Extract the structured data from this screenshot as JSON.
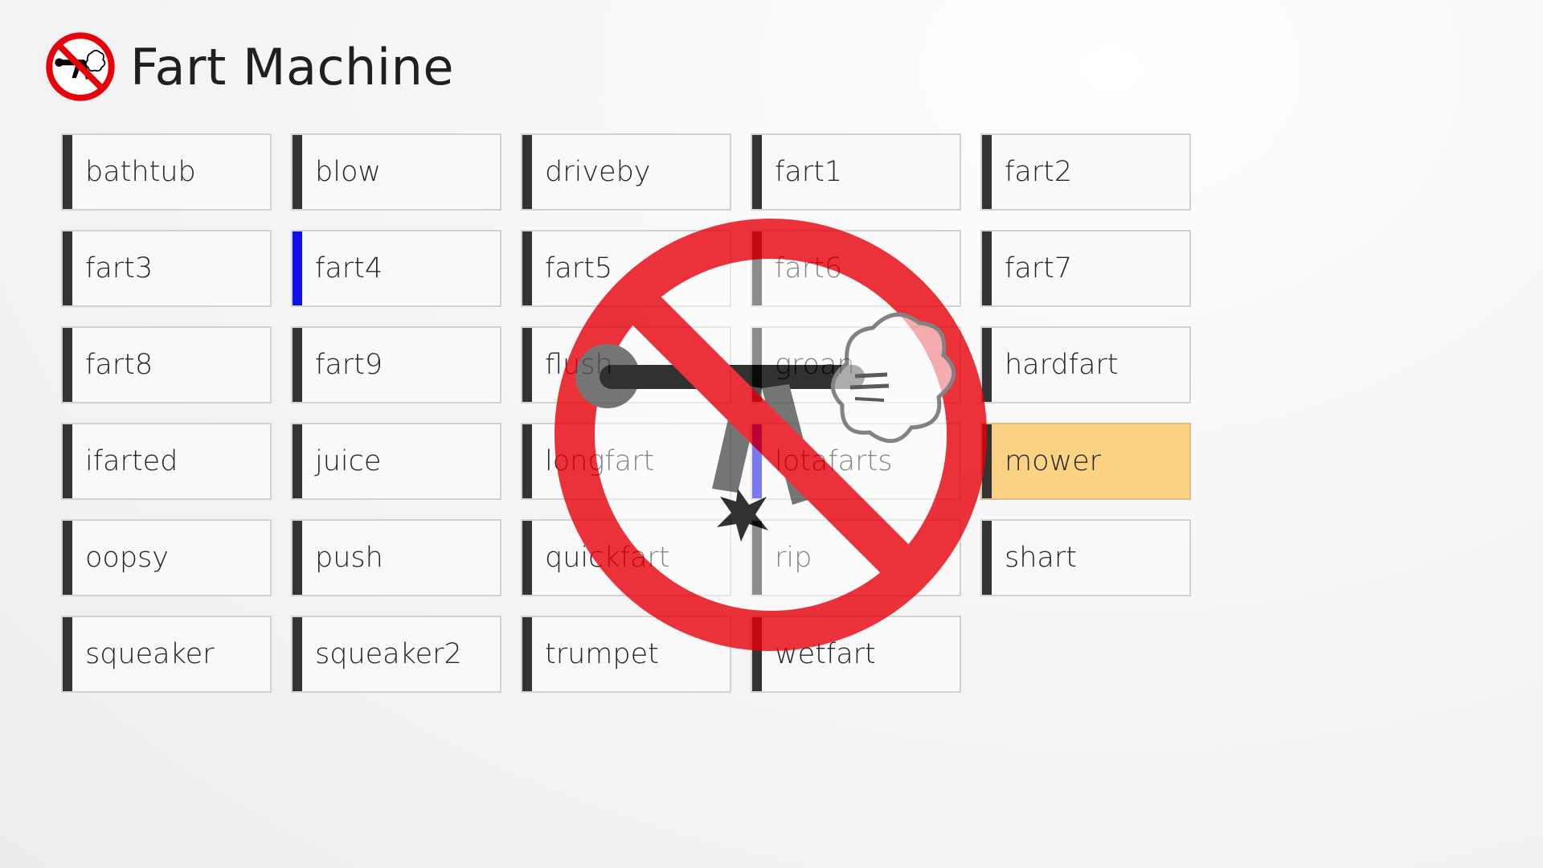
{
  "app": {
    "title": "Fart Machine",
    "logo_icon": "no-farting-icon"
  },
  "colors": {
    "accent_playing": "#1010e8",
    "selected_tile": "#fbd382",
    "tile_bar": "#333333",
    "prohibition_red": "#e8000b"
  },
  "sounds": [
    {
      "label": "bathtub",
      "state": "normal"
    },
    {
      "label": "blow",
      "state": "normal"
    },
    {
      "label": "driveby",
      "state": "normal"
    },
    {
      "label": "fart1",
      "state": "normal"
    },
    {
      "label": "fart2",
      "state": "normal"
    },
    {
      "label": "fart3",
      "state": "normal"
    },
    {
      "label": "fart4",
      "state": "playing"
    },
    {
      "label": "fart5",
      "state": "normal"
    },
    {
      "label": "fart6",
      "state": "normal"
    },
    {
      "label": "fart7",
      "state": "normal"
    },
    {
      "label": "fart8",
      "state": "normal"
    },
    {
      "label": "fart9",
      "state": "normal"
    },
    {
      "label": "flush",
      "state": "normal"
    },
    {
      "label": "groan",
      "state": "normal"
    },
    {
      "label": "hardfart",
      "state": "normal"
    },
    {
      "label": "ifarted",
      "state": "normal"
    },
    {
      "label": "juice",
      "state": "normal"
    },
    {
      "label": "longfart",
      "state": "normal"
    },
    {
      "label": "lotafarts",
      "state": "playing"
    },
    {
      "label": "mower",
      "state": "selected"
    },
    {
      "label": "oopsy",
      "state": "normal"
    },
    {
      "label": "push",
      "state": "normal"
    },
    {
      "label": "quickfart",
      "state": "normal"
    },
    {
      "label": "rip",
      "state": "normal"
    },
    {
      "label": "shart",
      "state": "normal"
    },
    {
      "label": "squeaker",
      "state": "normal"
    },
    {
      "label": "squeaker2",
      "state": "normal"
    },
    {
      "label": "trumpet",
      "state": "normal"
    },
    {
      "label": "wetfart",
      "state": "normal"
    }
  ]
}
